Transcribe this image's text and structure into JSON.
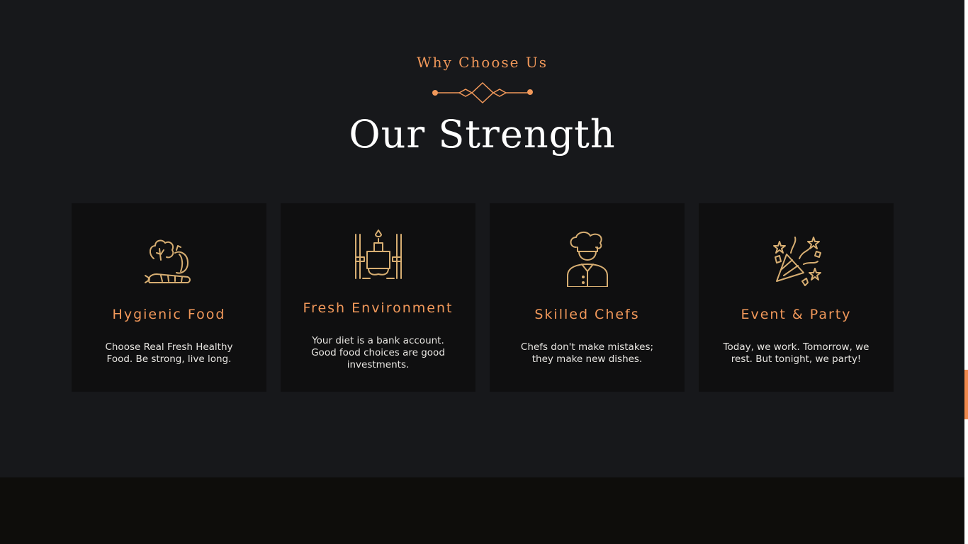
{
  "section": {
    "eyebrow": "Why Choose Us",
    "title": "Our Strength"
  },
  "colors": {
    "accent": "#f1985a",
    "icon": "#d7ae72",
    "background": "#17181b",
    "card": "#0f0f10",
    "footer": "#0e0d0b"
  },
  "features": [
    {
      "icon": "vegetables-icon",
      "title": "Hygienic Food",
      "text": "Choose Real Fresh Healthy Food. Be strong, live long."
    },
    {
      "icon": "dining-table-icon",
      "title": "Fresh Environment",
      "text": "Your diet is a bank account. Good food choices are good investments."
    },
    {
      "icon": "chef-icon",
      "title": "Skilled Chefs",
      "text": "Chefs don't make mistakes; they make new dishes."
    },
    {
      "icon": "party-popper-icon",
      "title": "Event & Party",
      "text": "Today, we work. Tomorrow, we rest. But tonight, we party!"
    }
  ]
}
